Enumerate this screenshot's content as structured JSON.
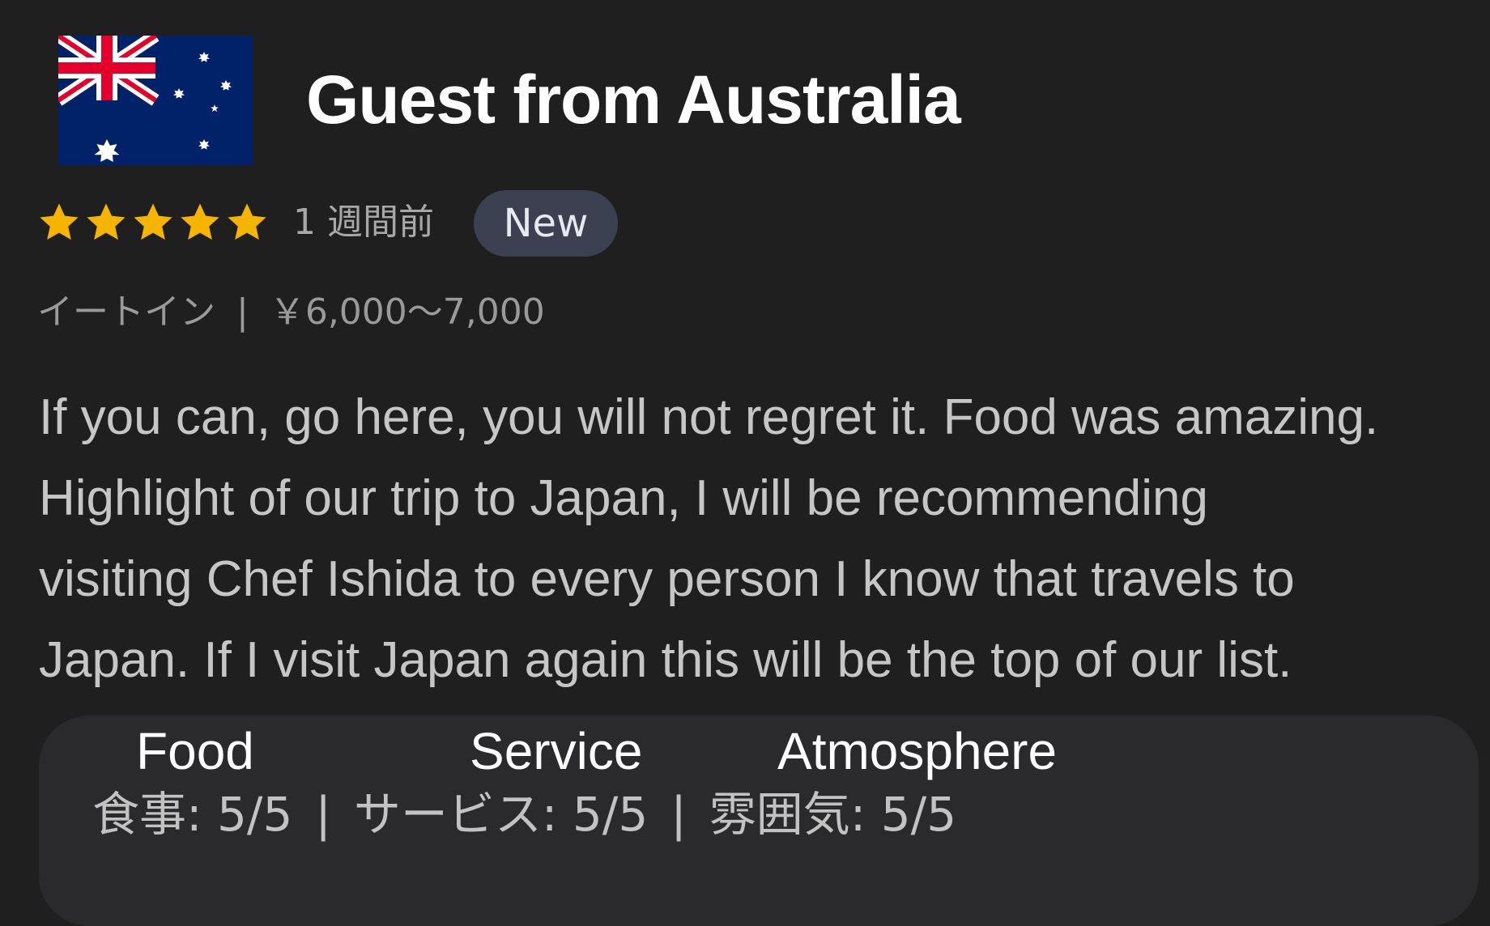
{
  "header": {
    "flag_icon": "australia-flag-icon",
    "title": "Guest from Australia"
  },
  "rating": {
    "stars": 5,
    "star_color": "#f5b400",
    "time_ago": "1 週間前",
    "badge": "New"
  },
  "dining_info": {
    "type": "イートイン",
    "separator": "|",
    "price": "￥6,000〜7,000"
  },
  "review": {
    "lines": [
      "If you can, go here, you will not regret it. Food was amazing.",
      "Highlight of our trip to Japan, I will be recommending",
      "visiting Chef Ishida to every person I know that travels to",
      "Japan. If I visit Japan again this will be the top of our list."
    ]
  },
  "sub_ratings": {
    "labels": [
      "Food",
      "Service",
      "Atmosphere"
    ],
    "scores": [
      {
        "label": "食事",
        "value": "5/5"
      },
      {
        "label": "サービス",
        "value": "5/5"
      },
      {
        "label": "雰囲気",
        "value": "5/5"
      }
    ],
    "separator": "|"
  },
  "colors": {
    "background": "#1f1f1f",
    "panel": "#2a2a2c",
    "badge": "#3b4150",
    "flag_blue": "#012169",
    "flag_red": "#e4002b"
  }
}
